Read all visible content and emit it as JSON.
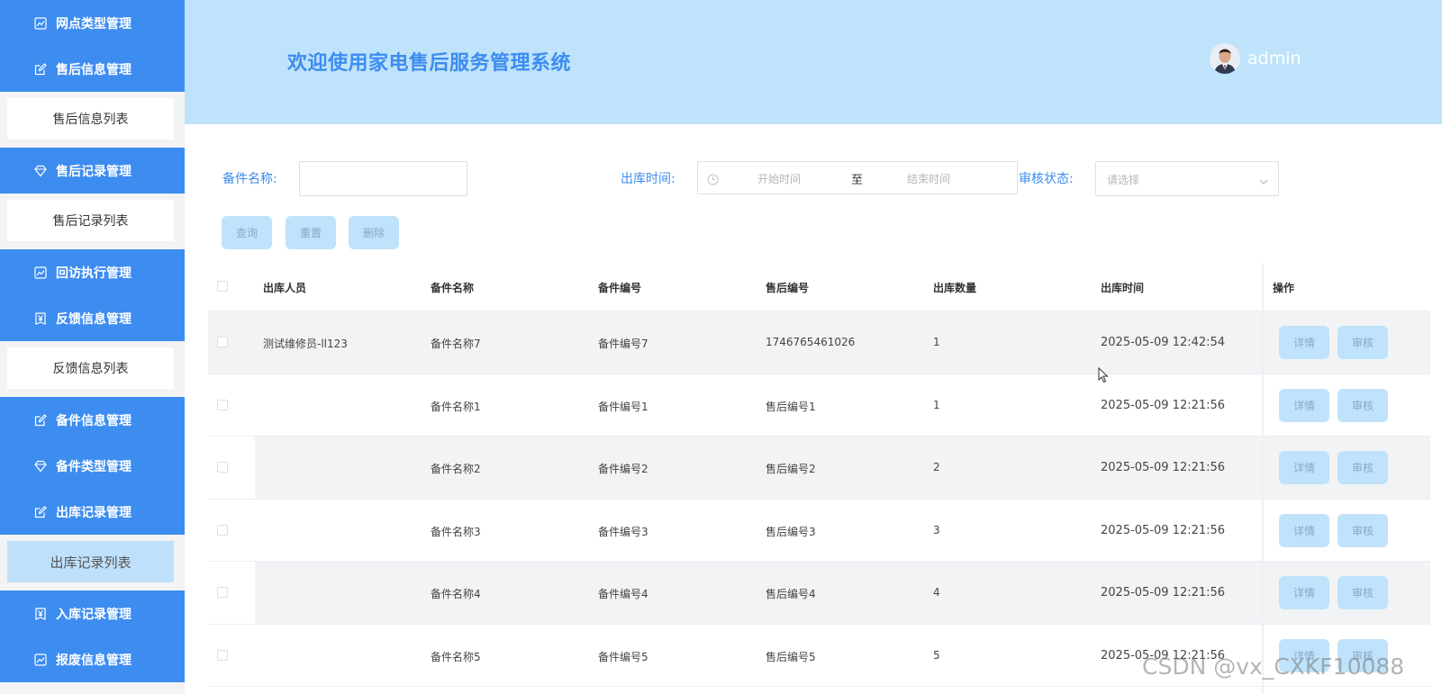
{
  "sidebar": {
    "items": [
      {
        "type": "group",
        "label": "网点类型管理",
        "icon": "chart-icon"
      },
      {
        "type": "group",
        "label": "售后信息管理",
        "icon": "edit-icon"
      },
      {
        "type": "sub",
        "label": "售后信息列表"
      },
      {
        "type": "group",
        "label": "售后记录管理",
        "icon": "diamond-icon"
      },
      {
        "type": "sub",
        "label": "售后记录列表"
      },
      {
        "type": "group",
        "label": "回访执行管理",
        "icon": "chart-icon"
      },
      {
        "type": "group",
        "label": "反馈信息管理",
        "icon": "yen-icon"
      },
      {
        "type": "sub",
        "label": "反馈信息列表"
      },
      {
        "type": "group",
        "label": "备件信息管理",
        "icon": "edit-icon"
      },
      {
        "type": "group",
        "label": "备件类型管理",
        "icon": "diamond-icon"
      },
      {
        "type": "group",
        "label": "出库记录管理",
        "icon": "edit-icon"
      },
      {
        "type": "sub",
        "label": "出库记录列表",
        "active": true
      },
      {
        "type": "group",
        "label": "入库记录管理",
        "icon": "yen-icon"
      },
      {
        "type": "group",
        "label": "报废信息管理",
        "icon": "chart-icon"
      }
    ]
  },
  "header": {
    "title": "欢迎使用家电售后服务管理系统",
    "user": "admin"
  },
  "filters": {
    "part_name_label": "备件名称:",
    "part_name_value": "",
    "out_time_label": "出库时间:",
    "start_placeholder": "开始时间",
    "range_sep": "至",
    "end_placeholder": "结束时间",
    "status_label": "审核状态:",
    "status_placeholder": "请选择"
  },
  "actions": {
    "query": "查询",
    "reset": "重置",
    "delete": "删除"
  },
  "table": {
    "columns": [
      "出库人员",
      "备件名称",
      "备件编号",
      "售后编号",
      "出库数量",
      "出库时间",
      "操作"
    ],
    "detail_label": "详情",
    "audit_label": "审核",
    "rows": [
      [
        "测试维修员-ll123",
        "备件名称7",
        "备件编号7",
        "1746765461026",
        "1",
        "2025-05-09 12:42:54"
      ],
      [
        "",
        "备件名称1",
        "备件编号1",
        "售后编号1",
        "1",
        "2025-05-09 12:21:56"
      ],
      [
        "",
        "备件名称2",
        "备件编号2",
        "售后编号2",
        "2",
        "2025-05-09 12:21:56"
      ],
      [
        "",
        "备件名称3",
        "备件编号3",
        "售后编号3",
        "3",
        "2025-05-09 12:21:56"
      ],
      [
        "",
        "备件名称4",
        "备件编号4",
        "售后编号4",
        "4",
        "2025-05-09 12:21:56"
      ],
      [
        "",
        "备件名称5",
        "备件编号5",
        "售后编号5",
        "5",
        "2025-05-09 12:21:56"
      ]
    ]
  },
  "watermark": "CSDN @vx_CXKF10088",
  "colors": {
    "primary": "#3d8cf0",
    "header_bg": "#bfe3fa",
    "button_bg": "#bfe3fa"
  }
}
